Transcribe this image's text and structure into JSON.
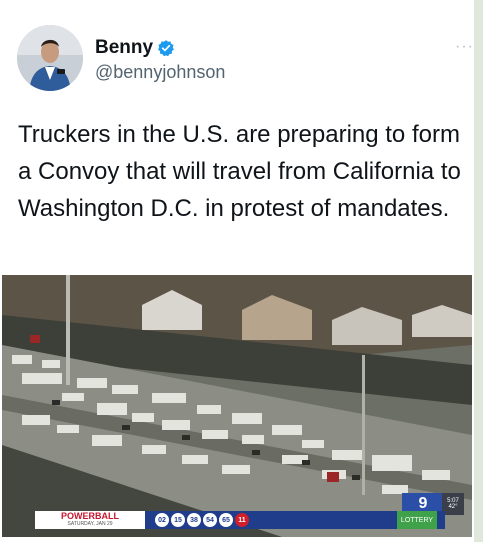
{
  "tweet": {
    "display_name": "Benny",
    "handle": "@bennyjohnson",
    "more_glyph": "···",
    "text": "Truckers in the U.S. are preparing to form a Convoy that will travel from California to Washington D.C. in protest of mandates."
  },
  "media": {
    "ticker": {
      "brand": "POWERBALL",
      "brand_sub": "SATURDAY, JAN 29",
      "balls": [
        "02",
        "15",
        "38",
        "54",
        "65"
      ],
      "power_ball": "11",
      "tag": "LOTTERY"
    },
    "station_logo": "9",
    "weather": {
      "time": "5:07",
      "temp": "42°"
    }
  },
  "colors": {
    "verified": "#1d9bf0",
    "handle": "#536471",
    "ticker_bg": "#1f3d8a"
  },
  "icons": [
    "verified-badge-icon",
    "more-options-icon"
  ]
}
